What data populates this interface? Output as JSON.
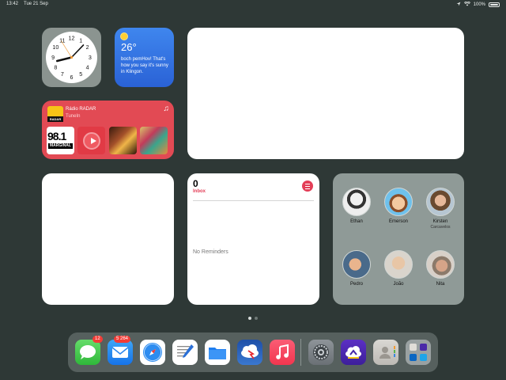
{
  "status_bar": {
    "time": "13:42",
    "date": "Tue 21 Sep",
    "battery_percent": "100%",
    "icons": [
      "location-icon",
      "wifi-icon",
      "battery-icon"
    ]
  },
  "weather": {
    "temperature": "26°",
    "description": "boch pemHov! That's how you say it's sunny in Klingon.",
    "icon": "sun-icon"
  },
  "radio": {
    "title": "Rádio RADAR",
    "subtitle": "TuneIn",
    "logo_text": "RADAR",
    "tile1_number": "98.1",
    "tile1_name": "MARGINAL",
    "icon": "music-note-icon"
  },
  "reminders": {
    "count": "0",
    "list_name": "Inbox",
    "empty_text": "No Reminders"
  },
  "contacts": [
    {
      "name": "Ethan",
      "sub": ""
    },
    {
      "name": "Emerson",
      "sub": ""
    },
    {
      "name": "Kirsten",
      "sub": "Carcavelos"
    },
    {
      "name": "Pedro",
      "sub": ""
    },
    {
      "name": "João",
      "sub": ""
    },
    {
      "name": "Nita",
      "sub": ""
    }
  ],
  "page_dots": {
    "count": 2,
    "active": 0
  },
  "dock": {
    "messages_badge": "12",
    "mail_badge": "5 264",
    "apps": [
      "Messages",
      "Mail",
      "Safari",
      "Notes",
      "Files",
      "Weather Radar",
      "Music",
      "Settings",
      "Cloud App",
      "Contacts",
      "Folder"
    ]
  },
  "colors": {
    "background": "#2e3836",
    "weather": "#3a7ae8",
    "radio": "#e24a54",
    "reminders_accent": "#e33e57",
    "dock": "#56605e"
  }
}
